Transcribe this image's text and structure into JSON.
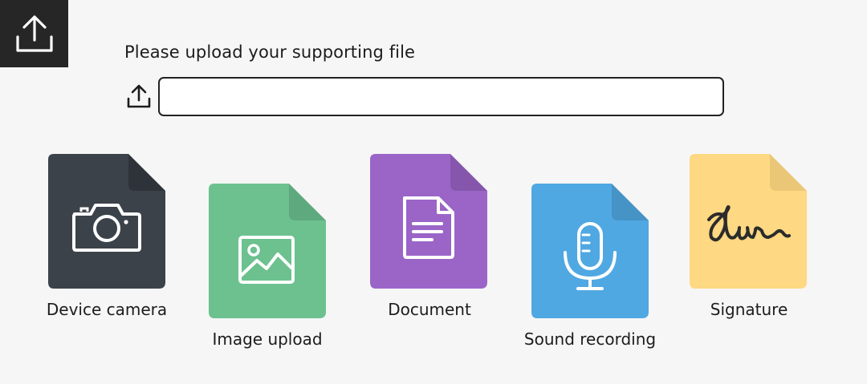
{
  "upload": {
    "prompt": "Please upload your supporting file",
    "field_value": ""
  },
  "options": [
    {
      "label": "Device camera",
      "color": "#3b4249",
      "icon": "camera-icon"
    },
    {
      "label": "Image upload",
      "color": "#6cc18f",
      "icon": "image-icon"
    },
    {
      "label": "Document",
      "color": "#9b65c8",
      "icon": "document-icon"
    },
    {
      "label": "Sound recording",
      "color": "#50a8e2",
      "icon": "microphone-icon"
    },
    {
      "label": "Signature",
      "color": "#fed882",
      "icon": "signature-icon"
    }
  ],
  "colors": {
    "corner_badge": "#262626",
    "background": "#f6f6f6"
  }
}
